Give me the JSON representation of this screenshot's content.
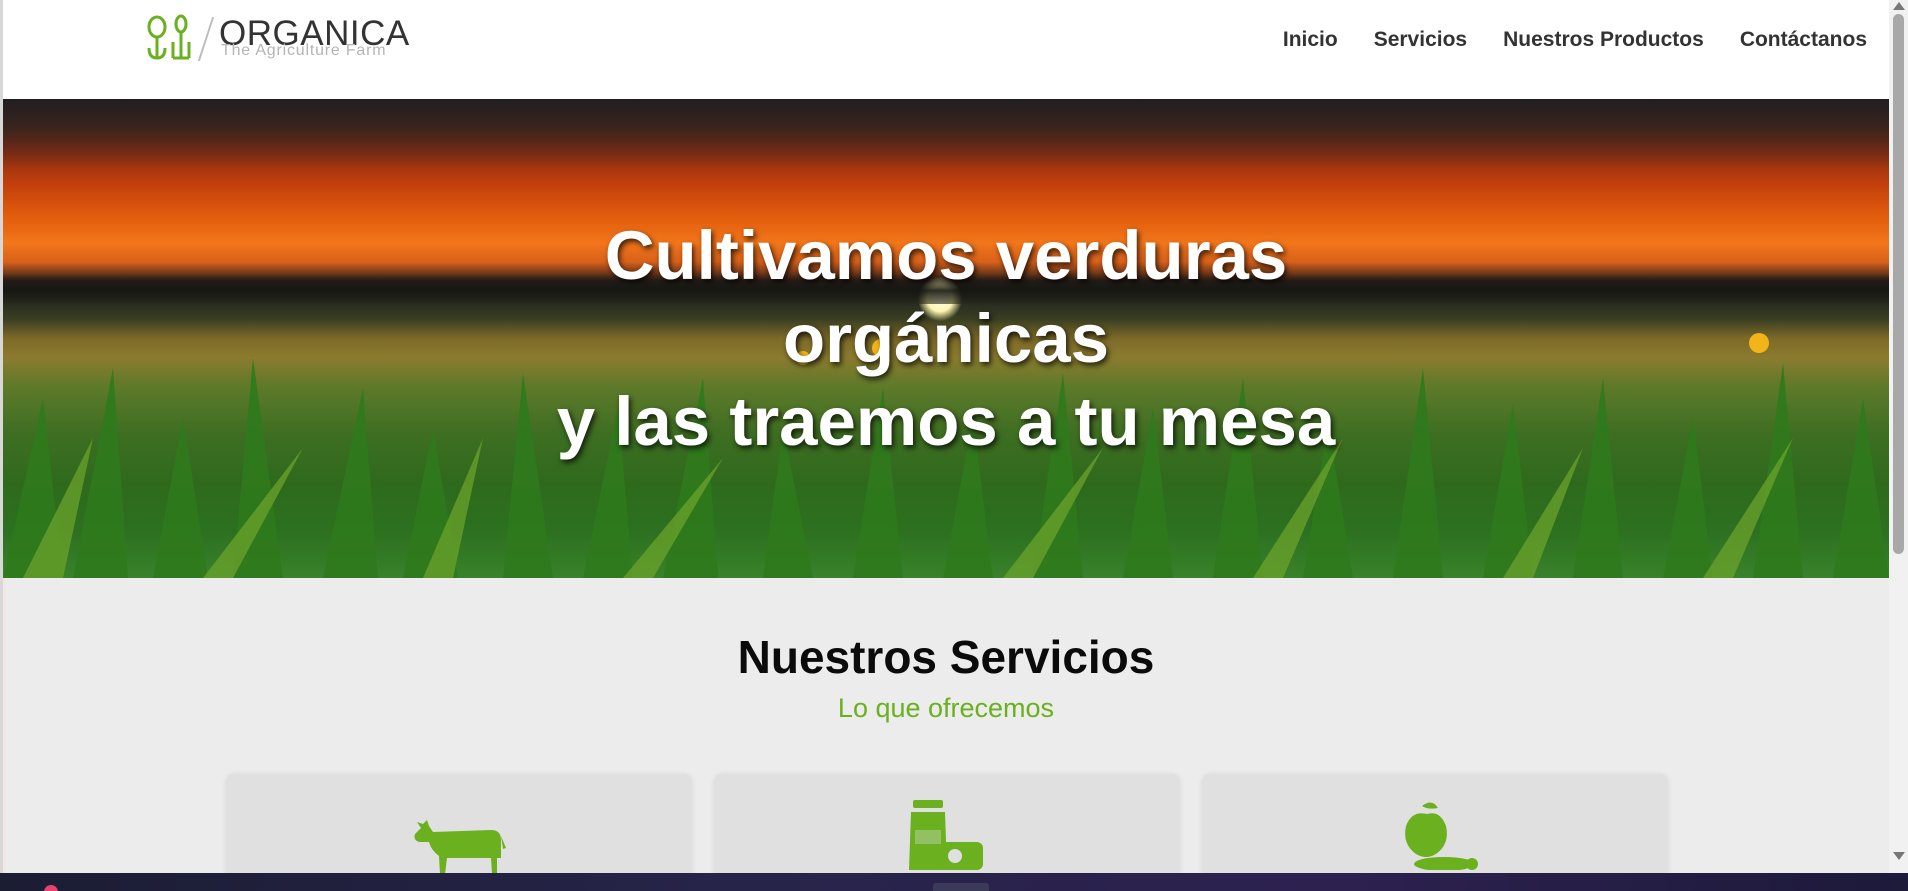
{
  "header": {
    "logo_name": "ORGANICA",
    "logo_tagline": "The Agriculture Farm",
    "nav": [
      {
        "label": "Inicio"
      },
      {
        "label": "Servicios"
      },
      {
        "label": "Nuestros Productos"
      },
      {
        "label": "Contáctanos"
      }
    ]
  },
  "hero": {
    "line1": "Cultivamos verduras",
    "line2": "orgánicas",
    "line3": "y las traemos a tu mesa"
  },
  "services": {
    "title": "Nuestros Servicios",
    "subtitle": "Lo que ofrecemos",
    "cards": [
      {
        "icon": "cow-icon"
      },
      {
        "icon": "dairy-products-icon"
      },
      {
        "icon": "fruit-vegetables-icon"
      }
    ]
  },
  "colors": {
    "accent_green": "#6ab01f",
    "nav_text": "#333333",
    "section_bg": "#ececec",
    "card_bg": "#e0e0e0"
  }
}
